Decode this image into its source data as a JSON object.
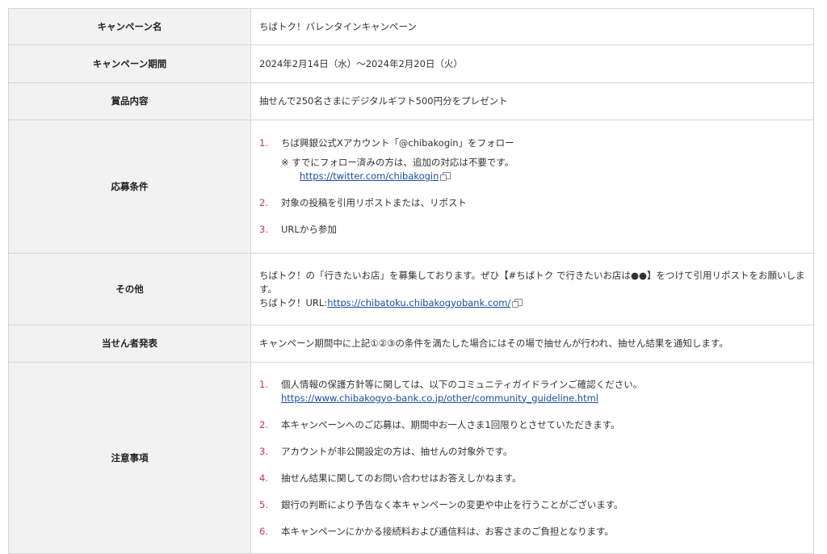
{
  "rows": {
    "name": {
      "label": "キャンペーン名",
      "value": "ちばトク！バレンタインキャンペーン"
    },
    "period": {
      "label": "キャンペーン期間",
      "value": "2024年2月14日（水）～2024年2月20日（火）"
    },
    "prize": {
      "label": "賞品内容",
      "value": "抽せんで250名さまにデジタルギフト500円分をプレゼント"
    },
    "conditions": {
      "label": "応募条件",
      "items": [
        {
          "num": "1.",
          "text": "ちば興銀公式Xアカウント「@chibakogin」をフォロー"
        },
        {
          "num": "2.",
          "text": "対象の投稿を引用リポストまたは、リポスト"
        },
        {
          "num": "3.",
          "text": "URLから参加"
        }
      ],
      "note": "※ すでにフォロー済みの方は、追加の対応は不要です。",
      "link": "https://twitter.com/chibakogin"
    },
    "other": {
      "label": "その他",
      "text": "ちばトク！の「行きたいお店」を募集しております。ぜひ【#ちばトク で行きたいお店は●●】をつけて引用リポストをお願いします。",
      "url_prefix": "ちばトク！URL:",
      "url": "https://chibatoku.chibakogyobank.com/"
    },
    "announce": {
      "label": "当せん者発表",
      "value": "キャンペーン期間中に上記①②③の条件を満たした場合にはその場で抽せんが行われ、抽せん結果を通知します。"
    },
    "notes": {
      "label": "注意事項",
      "items": [
        {
          "num": "1.",
          "text": "個人情報の保護方針等に関しては、以下のコミュニティガイドラインご確認ください。",
          "link": "https://www.chibakogyo-bank.co.jp/other/community_guideline.html"
        },
        {
          "num": "2.",
          "text": "本キャンペーンへのご応募は、期間中お一人さま1回限りとさせていただきます。"
        },
        {
          "num": "3.",
          "text": "アカウントが非公開設定の方は、抽せんの対象外です。"
        },
        {
          "num": "4.",
          "text": "抽せん結果に関してのお問い合わせはお答えしかねます。"
        },
        {
          "num": "5.",
          "text": "銀行の判断により予告なく本キャンペーンの変更や中止を行うことがございます。"
        },
        {
          "num": "6.",
          "text": "本キャンペーンにかかる接続料および通信料は、お客さまのご負担となります。"
        }
      ]
    }
  },
  "colors": {
    "accent": "#c8364a",
    "link": "#1a4fa0",
    "header_bg": "#f2f2f2",
    "border": "#d6d6d6"
  },
  "icons": {
    "external": "external-link-icon"
  }
}
